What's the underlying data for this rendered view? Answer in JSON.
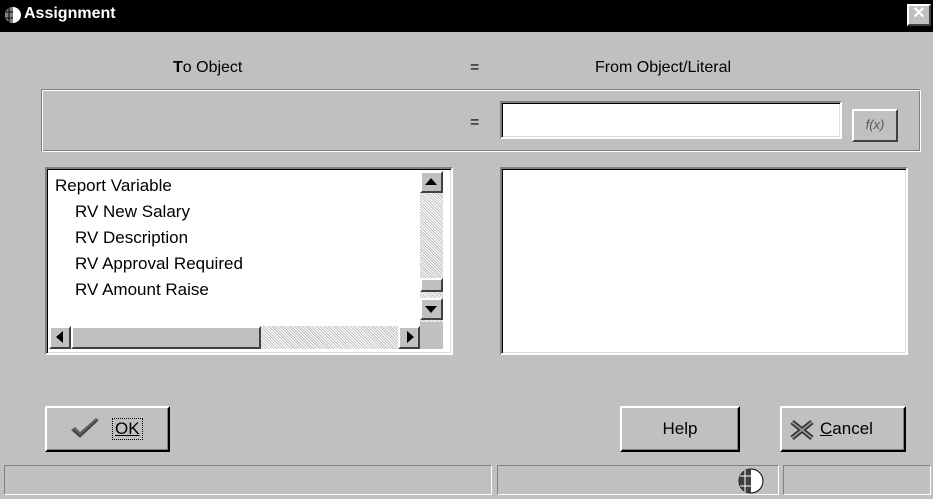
{
  "window": {
    "title": "Assignment",
    "close_glyph": "✕",
    "app_icon": "globe-icon"
  },
  "headers": {
    "to_object_first": "T",
    "to_object_rest": "o Object",
    "equals": "=",
    "from_object": "From Object/Literal"
  },
  "assignment": {
    "equals": "=",
    "from_value": "",
    "fx_label": "f(x)"
  },
  "tree": {
    "items": [
      {
        "label": "Report Variable",
        "level": 0
      },
      {
        "label": "RV New Salary",
        "level": 1
      },
      {
        "label": "RV Description",
        "level": 1
      },
      {
        "label": "RV Approval Required",
        "level": 1
      },
      {
        "label": "RV Amount Raise",
        "level": 1
      }
    ]
  },
  "buttons": {
    "ok": "OK",
    "help": "Help",
    "cancel_first": "C",
    "cancel_rest": "ancel"
  },
  "status": {
    "icon": "globe-icon"
  }
}
